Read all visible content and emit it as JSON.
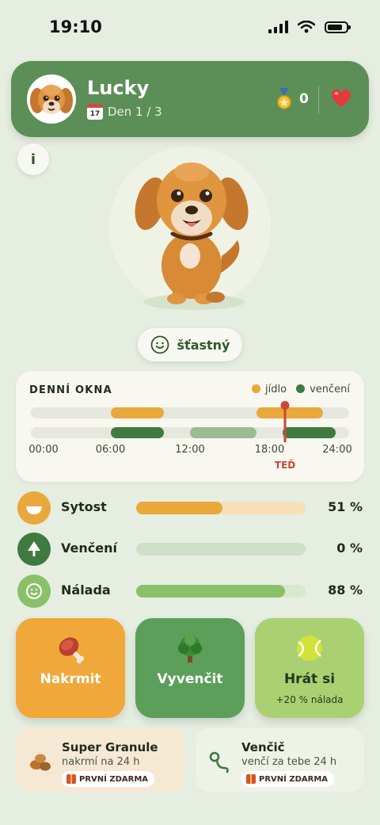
{
  "status_bar": {
    "time": "19:10"
  },
  "pet": {
    "name": "Lucky",
    "day_label": "Den 1 / 3",
    "calendar_day": "17",
    "medals": "0",
    "mood": "šťastný"
  },
  "daily_windows": {
    "title": "DENNÍ OKNA",
    "legend": {
      "food": "jídlo",
      "walk": "venčení"
    },
    "ticks": [
      "00:00",
      "06:00",
      "12:00",
      "18:00",
      "24:00"
    ],
    "now_label": "TEĎ",
    "now_hour": 19.17,
    "food_windows": [
      [
        6,
        10
      ],
      [
        17,
        22
      ]
    ],
    "walk_windows": [
      [
        6,
        10
      ],
      [
        12,
        17
      ],
      [
        19,
        23
      ]
    ],
    "colors": {
      "food": "#e8a83a",
      "walk": "#3f7a40",
      "walk_light": "#9bbb92",
      "now": "#c9473a"
    }
  },
  "stats": [
    {
      "label": "Sytost",
      "value": "51 %",
      "fraction": 0.51,
      "color": "#e8a83a",
      "track": "#f6dfb6",
      "icon_bg": "#e8a83a"
    },
    {
      "label": "Venčení",
      "value": "0 %",
      "fraction": 0.0,
      "color": "#5c8f57",
      "track": "#cfdfc8",
      "icon_bg": "#3f7a40"
    },
    {
      "label": "Nálada",
      "value": "88 %",
      "fraction": 0.88,
      "color": "#8bc06a",
      "track": "#d7e8cb",
      "icon_bg": "#8bc06a"
    }
  ],
  "actions": {
    "feed": {
      "label": "Nakrmit",
      "color": "#f0a83a"
    },
    "walk": {
      "label": "Vyvenčit",
      "color": "#5c9f5a"
    },
    "play": {
      "label": "Hrát si",
      "sub": "+20 % nálada",
      "color": "#a9d172"
    }
  },
  "shop": [
    {
      "title": "Super Granule",
      "subtitle": "nakrmí na 24 h",
      "badge": "PRVNÍ ZDARMA",
      "bg": "#f6e9d4"
    },
    {
      "title": "Venčič",
      "subtitle": "venčí za tebe 24 h",
      "badge": "PRVNÍ ZDARMA",
      "bg": "#eef2e7"
    }
  ]
}
